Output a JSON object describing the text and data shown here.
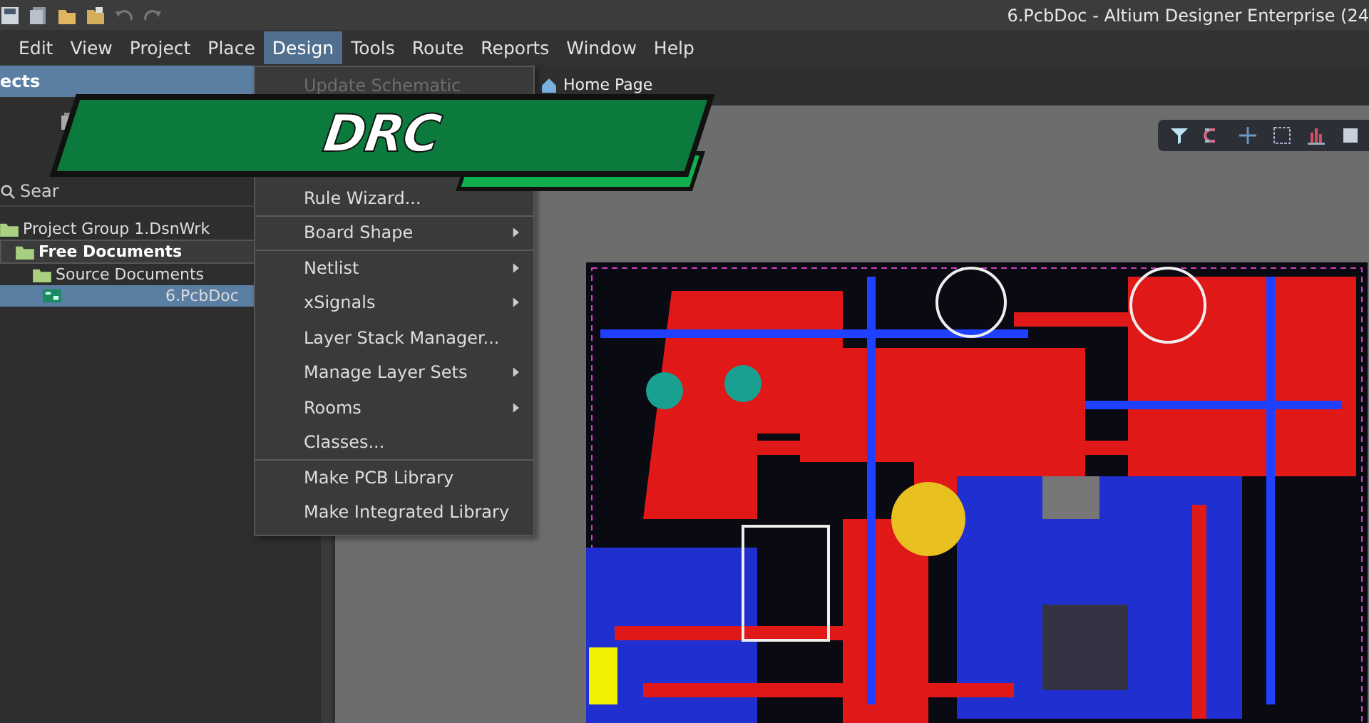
{
  "window": {
    "title": "6.PcbDoc - Altium Designer Enterprise (24"
  },
  "menu_bar": [
    {
      "label": "Edit",
      "selected": false
    },
    {
      "label": "View",
      "selected": false
    },
    {
      "label": "Project",
      "selected": false
    },
    {
      "label": "Place",
      "selected": false
    },
    {
      "label": "Design",
      "selected": true
    },
    {
      "label": "Tools",
      "selected": false
    },
    {
      "label": "Route",
      "selected": false
    },
    {
      "label": "Reports",
      "selected": false
    },
    {
      "label": "Window",
      "selected": false
    },
    {
      "label": "Help",
      "selected": false
    }
  ],
  "projects_panel": {
    "title": "ects",
    "search": {
      "placeholder": "Sear"
    },
    "tree": [
      {
        "label": "Project Group 1.DsnWrk",
        "selected": false,
        "children": [
          {
            "label": "Free Documents",
            "selected": false,
            "children": [
              {
                "label": "Source Documents",
                "selected": false,
                "children": [
                  {
                    "label": "6.PcbDoc",
                    "selected": true
                  }
                ]
              }
            ]
          }
        ]
      }
    ]
  },
  "document_tabs": [
    {
      "label": "Home Page"
    }
  ],
  "design_menu": [
    {
      "label": "Update Schematic",
      "disabled": true,
      "submenu": false,
      "separator_before": false
    },
    {
      "label": "Rule Wizard...",
      "disabled": false,
      "submenu": false,
      "separator_before": false
    },
    {
      "label": "Board Shape",
      "disabled": false,
      "submenu": true,
      "separator_before": true
    },
    {
      "label": "Netlist",
      "disabled": false,
      "submenu": true,
      "separator_before": true
    },
    {
      "label": "xSignals",
      "disabled": false,
      "submenu": true,
      "separator_before": false
    },
    {
      "label": "Layer Stack Manager...",
      "disabled": false,
      "submenu": false,
      "separator_before": false
    },
    {
      "label": "Manage Layer Sets",
      "disabled": false,
      "submenu": true,
      "separator_before": false
    },
    {
      "label": "Rooms",
      "disabled": false,
      "submenu": true,
      "separator_before": false
    },
    {
      "label": "Classes...",
      "disabled": false,
      "submenu": false,
      "separator_before": false
    },
    {
      "label": "Make PCB Library",
      "disabled": false,
      "submenu": false,
      "separator_before": true
    },
    {
      "label": "Make Integrated Library",
      "disabled": false,
      "submenu": false,
      "separator_before": false
    }
  ],
  "banner": {
    "title": "DRC"
  }
}
